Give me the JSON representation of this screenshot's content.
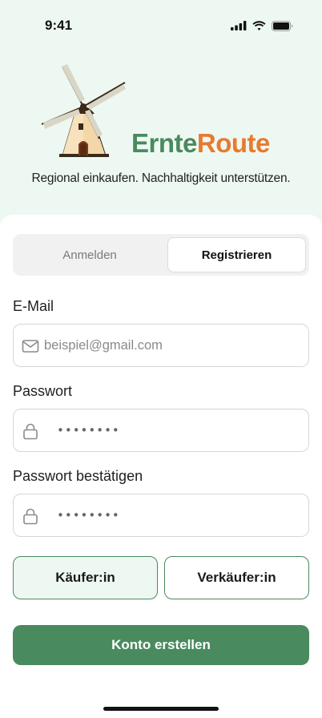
{
  "status": {
    "time": "9:41"
  },
  "brand": {
    "part1": "Ernte",
    "part2": "Route"
  },
  "tagline": "Regional einkaufen. Nachhaltigkeit unterstützen.",
  "tabs": {
    "login": "Anmelden",
    "register": "Registrieren",
    "active": "register"
  },
  "form": {
    "email_label": "E-Mail",
    "email_placeholder": "beispiel@gmail.com",
    "password_label": "Passwort",
    "password_mask": "••••••••",
    "confirm_label": "Passwort bestätigen",
    "confirm_mask": "••••••••"
  },
  "roles": {
    "buyer": "Käufer:in",
    "seller": "Verkäufer:in",
    "selected": "buyer"
  },
  "cta": "Konto erstellen",
  "colors": {
    "primary": "#4a8a5f",
    "accent": "#e87a2e",
    "hero_bg": "#eef8f2"
  }
}
